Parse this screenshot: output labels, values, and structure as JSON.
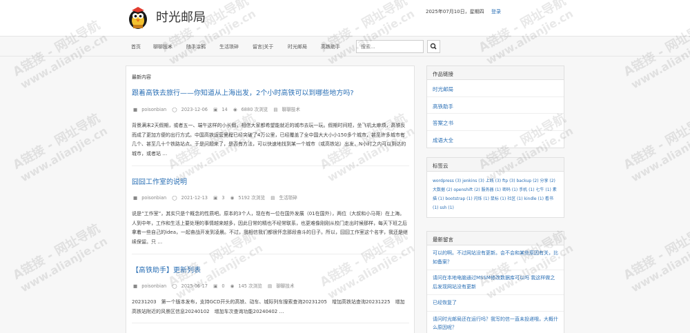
{
  "header": {
    "site_title": "时光邮局",
    "date": "2025年07月10日，星期四",
    "login": "登录"
  },
  "nav": {
    "items": [
      "首页",
      "聊聊技术",
      "随手涂鸦",
      "生活琐碎",
      "留言|关于",
      "时光邮局",
      "高铁助手"
    ],
    "search_placeholder": "搜索..."
  },
  "main": {
    "section_label": "最新内容",
    "posts": [
      {
        "title": "跟着高铁去旅行——你知道从上海出发，2个小时高铁可以到哪些地方吗?",
        "author": "poisonbian",
        "date": "2023-12-06",
        "comments": "14",
        "views": "6880 次浏览",
        "category": "聊聊技术",
        "excerpt": "背景满末2天假期，或者五一、端午这样的小长假，相信大家都希望能就近的城市去玩一玩。假期时间短，坐飞机太麻烦，高铁反而成了更加方便的出行方式。中国高铁运营里程已经突破了4万公里，已经覆盖了全中国大大小小150多个城市，甚至许多城市有几个、甚至几十个铁路站点。于是问题来了，是否有方法，可以快速地找到某一个城市（或高铁站）出发，N小时之内可以到达的城市，或者站 …"
      },
      {
        "title": "囧囧工作室的说明",
        "author": "poisonbian",
        "date": "2021-12-13",
        "comments": "3",
        "views": "5192 次浏览",
        "category": "生活琐碎",
        "excerpt": "说是“工作室”，其实只是个概念的性质吧。原本的3个人，现在有一位在国外发展（01在国外），两位（大叔和小马哥）在上海。人到中年，工作和生活上要处理的事情越来越多，因此日常的精也不经常联系，也更难像刚刚从校门走出时候那样，每天下班之后拿着一些自己的idea，一起奋战开发到凌晨。不过，我相信我们都很怀念那段奋斗的日子。所以，囧囧工作室这个名字，我还是继续保留。只 …"
      },
      {
        "title": "【高铁助手】更新列表",
        "author": "poisonbian",
        "date": "2025-06-17",
        "comments": "0",
        "views": "145 次浏览",
        "category": "聊聊技术",
        "excerpt": "20231203　第一个版本发布，支持GCD开头的高铁、动车、城际列车搜索查询20231205　增加高铁站查询20231225　增加高铁站附近的风景区信息20240102　增加车次查询功能20240402 …"
      }
    ]
  },
  "sidebar": {
    "works": {
      "title": "作品链接",
      "links": [
        "时光邮局",
        "高铁助手",
        "答案之书",
        "成语大全"
      ]
    },
    "tags": {
      "title": "标签云",
      "text": "wordpress (3) jenkins (3) 上线 (3) ftp (3) backup (2) 分享 (2) 大数据 (2) openshift (2) 服务器 (1) 密码 (1) 手机 (1) 七牛 (1) 素描 (1) bootstrap (1) 闪烁 (1) 鼠标 (1) 社区 (1) kindle (1) 看书 (1) ssh (1)"
    },
    "comments": {
      "title": "最新留言",
      "items": [
        "可以的啊。不过网站没有更新。会不会和某些原因有关，比如备案？",
        "请问在本地电脑通过MSSM修改数据库可以吗 我这样做之后发现网站没有更新",
        "已经恢复了",
        "请问时光邮局还在运行吗？我写的信一直未投递哦，大概什么原因呢？"
      ]
    }
  },
  "watermark": {
    "line1": "A链接 - 网址导航",
    "line2": "www.alianjie.cn"
  }
}
